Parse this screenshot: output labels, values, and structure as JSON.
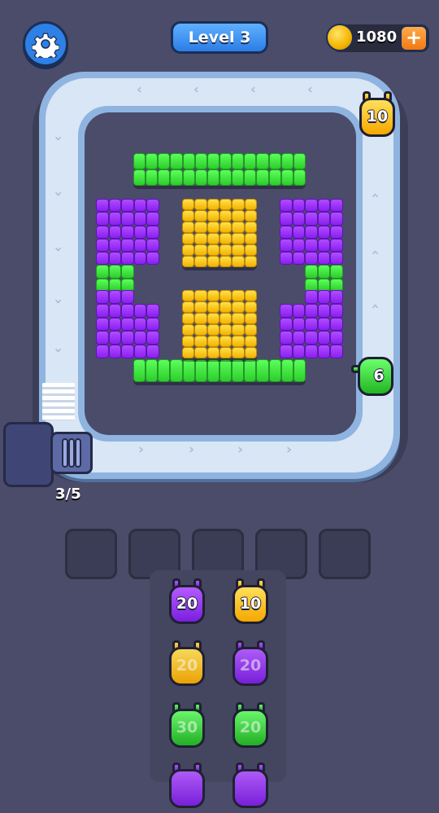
{
  "header": {
    "level_label": "Level 3",
    "coins": "1080",
    "plus_label": "+"
  },
  "belt": {
    "counter": "3/5"
  },
  "on_track_shooters": [
    {
      "color": "yellow",
      "count": "10"
    },
    {
      "color": "green",
      "count": "6"
    }
  ],
  "slots": [
    "empty",
    "empty",
    "empty",
    "empty",
    "empty"
  ],
  "queue": {
    "column_1": [
      {
        "color": "purple",
        "count": "20"
      },
      {
        "color": "yellow",
        "count": "20"
      },
      {
        "color": "green",
        "count": "30"
      },
      {
        "color": "purple",
        "count": ""
      }
    ],
    "column_2": [
      {
        "color": "yellow",
        "count": "10"
      },
      {
        "color": "purple",
        "count": "20"
      },
      {
        "color": "green",
        "count": "20"
      },
      {
        "color": "purple",
        "count": ""
      }
    ]
  },
  "colors": {
    "green": "#3ee63e",
    "yellow": "#fcc81e",
    "purple": "#9b33f5",
    "background": "#4a4c6a",
    "track": "#d9e6f5"
  }
}
